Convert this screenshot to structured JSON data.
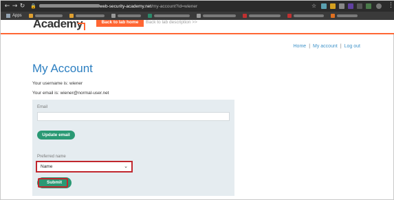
{
  "browser": {
    "url_host": "web-security-academy.net",
    "url_path": "/my-account?id=wiener",
    "bookmarks_label": "Apps"
  },
  "lab_header": {
    "logo": "Academy",
    "back_button": "Back to lab home",
    "back_desc": "Back to lab description >>"
  },
  "nav": {
    "home": "Home",
    "my_account": "My account",
    "log_out": "Log out",
    "separator": "|"
  },
  "page": {
    "title": "My Account",
    "username_line": "Your username is: wiener",
    "email_line": "Your email is: wiener@normal-user.net"
  },
  "form": {
    "email_label": "Email",
    "email_value": "",
    "update_email_button": "Update email",
    "preferred_name_label": "Preferred name",
    "preferred_name_value": "Name",
    "submit_button": "Submit"
  },
  "colors": {
    "accent_orange": "#ff6633",
    "title_blue": "#2c7fc1",
    "button_green": "#2a9974",
    "highlight_red": "#c0262d"
  },
  "icons": [
    "back-arrow-icon",
    "forward-arrow-icon",
    "reload-icon",
    "lock-icon",
    "star-icon",
    "apps-grid-icon",
    "chevron-down-icon",
    "kebab-menu-icon"
  ]
}
